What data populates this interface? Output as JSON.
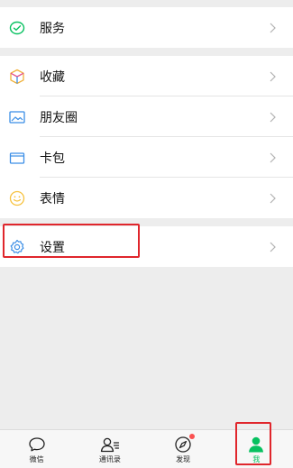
{
  "menu": {
    "services": {
      "label": "服务",
      "icon": "services-icon",
      "color": "#07c160"
    },
    "favorites": {
      "label": "收藏",
      "icon": "favorites-cube-icon",
      "color": "#f0b13a"
    },
    "moments": {
      "label": "朋友圈",
      "icon": "moments-photo-icon",
      "color": "#3b8ee6"
    },
    "cards": {
      "label": "卡包",
      "icon": "card-wallet-icon",
      "color": "#3b8ee6"
    },
    "stickers": {
      "label": "表情",
      "icon": "sticker-smile-icon",
      "color": "#f7c23e"
    },
    "settings": {
      "label": "设置",
      "icon": "settings-gear-icon",
      "color": "#3b8ee6"
    }
  },
  "tabbar": {
    "tabs": [
      {
        "label": "微信",
        "icon": "chat-bubble-icon",
        "active": false
      },
      {
        "label": "通讯录",
        "icon": "contacts-icon",
        "active": false
      },
      {
        "label": "发现",
        "icon": "discover-compass-icon",
        "active": false,
        "badge": "red-dot"
      },
      {
        "label": "我",
        "icon": "me-person-icon",
        "active": true
      }
    ]
  },
  "colors": {
    "accent_green": "#07c160",
    "highlight_red": "#e0262c",
    "background": "#ededed"
  }
}
